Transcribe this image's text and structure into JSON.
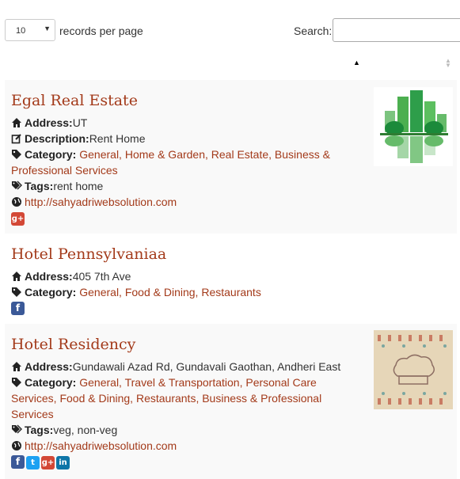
{
  "controls": {
    "length_value": "10",
    "length_label": "records per page",
    "search_label": "Search:",
    "search_value": ""
  },
  "listings": [
    {
      "title": "Egal Real Estate",
      "address_label": "Address:",
      "address": "UT",
      "description_label": "Description:",
      "description": "Rent Home",
      "category_label": "Category:",
      "categories_line1": "General, Home & Garden, Real Estate, Business &",
      "categories_line2": "Professional Services",
      "tags_label": "Tags:",
      "tags": "rent home",
      "website": "http://sahyadriwebsolution.com",
      "social": [
        "google-plus"
      ]
    },
    {
      "title": "Hotel Pennsylvaniaa",
      "address_label": "Address:",
      "address": "405 7th Ave",
      "category_label": "Category:",
      "categories_line1": "General, Food & Dining, Restaurants",
      "social": [
        "facebook"
      ]
    },
    {
      "title": "Hotel Residency",
      "address_label": "Address:",
      "address": "Gundawali Azad Rd, Gundavali Gaothan, Andheri East",
      "category_label": "Category:",
      "categories_line1": "General, Travel & Transportation, Personal Care",
      "categories_line2": "Services, Food & Dining, Restaurants, Business & Professional",
      "categories_line3": "Services",
      "tags_label": "Tags:",
      "tags": "veg, non-veg",
      "website": "http://sahyadriwebsolution.com",
      "social": [
        "facebook",
        "twitter",
        "google-plus",
        "linkedin"
      ]
    }
  ],
  "colors": {
    "link": "#a33a1a",
    "row_alt": "#f9f9f9"
  }
}
